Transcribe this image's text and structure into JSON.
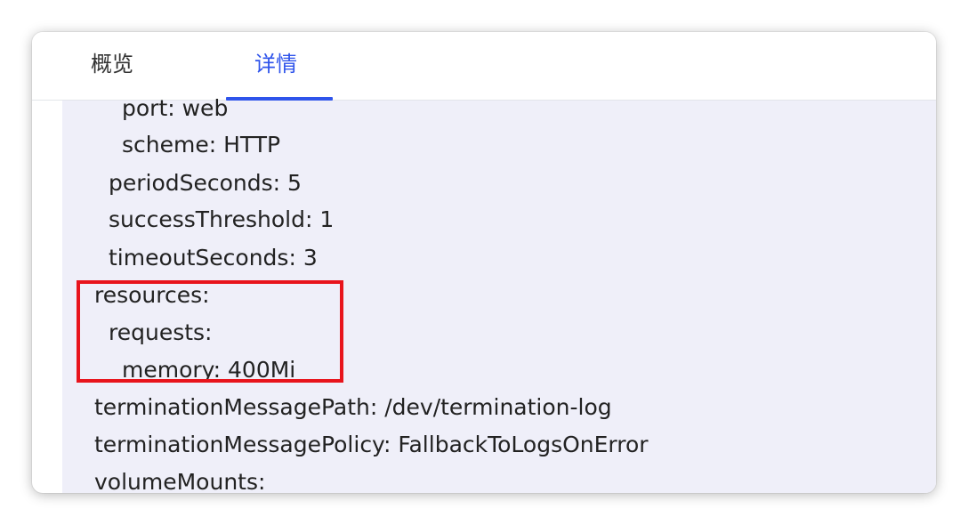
{
  "tabs": [
    {
      "label": "概览"
    },
    {
      "label": "详情"
    }
  ],
  "active_tab": "详情",
  "accent_color": "#2f54eb",
  "highlight_color": "#e8141c",
  "code_lines": [
    {
      "text": "port: web"
    },
    {
      "text": "scheme: HTTP"
    },
    {
      "text": "periodSeconds: 5"
    },
    {
      "text": "successThreshold: 1"
    },
    {
      "text": "timeoutSeconds: 3"
    },
    {
      "text": "resources:"
    },
    {
      "text": "requests:"
    },
    {
      "text": "memory: 400Mi"
    },
    {
      "text": "terminationMessagePath: /dev/termination-log"
    },
    {
      "text": "terminationMessagePolicy: FallbackToLogsOnError"
    },
    {
      "text": "volumeMounts:"
    }
  ]
}
